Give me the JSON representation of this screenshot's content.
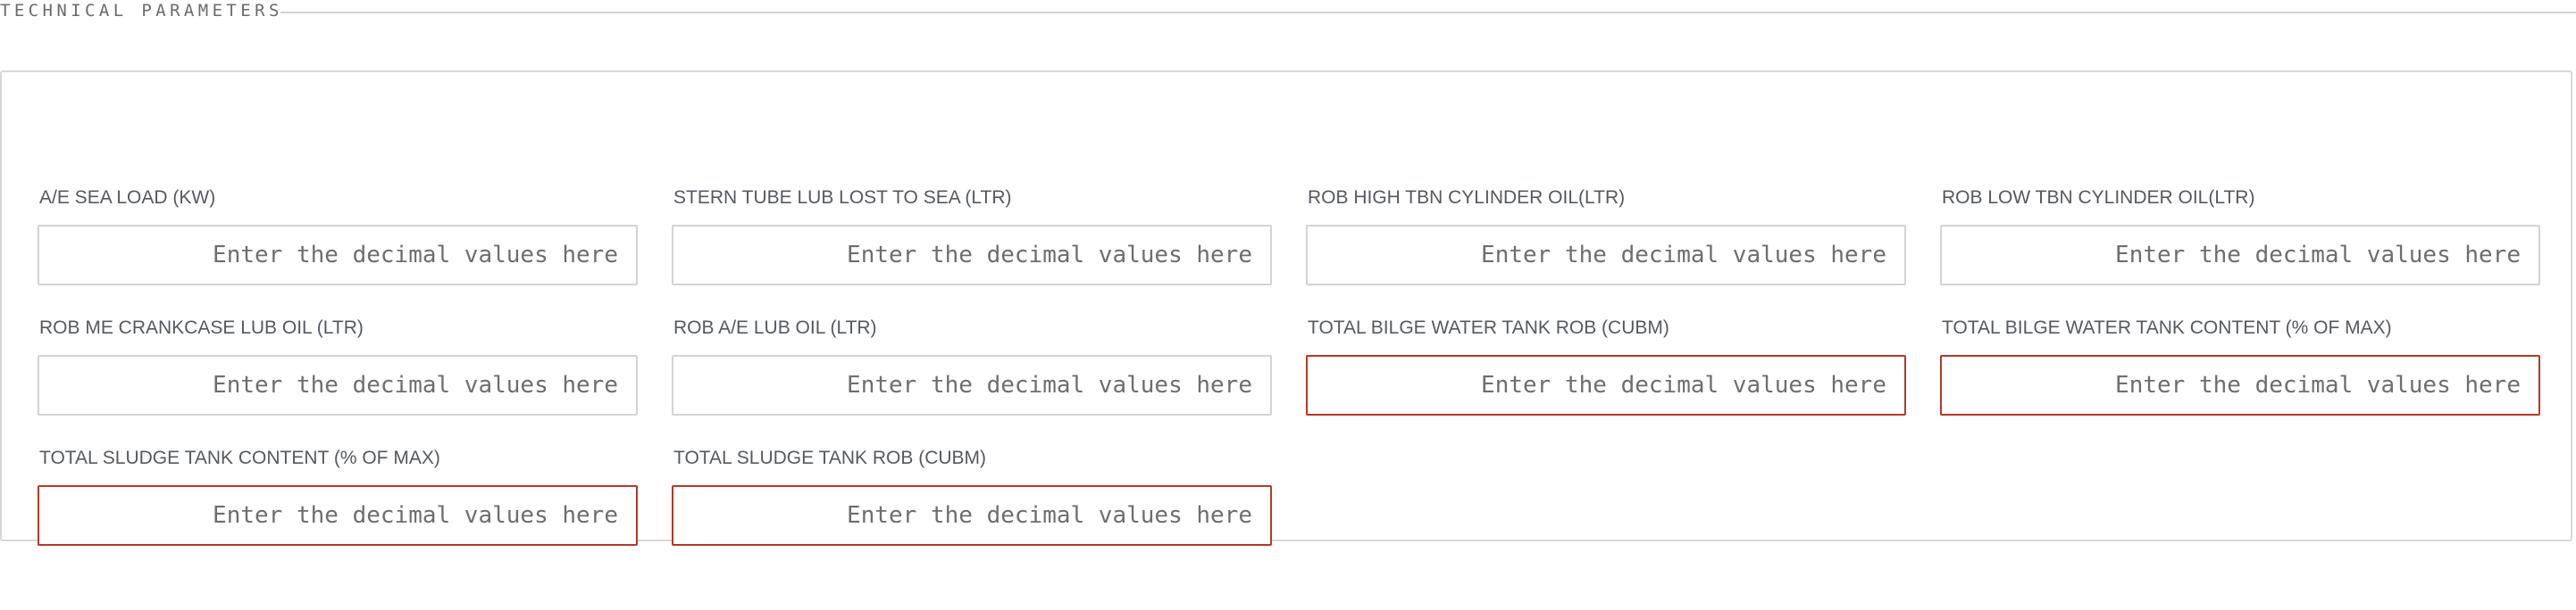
{
  "section": {
    "title": "TECHNICAL PARAMETERS"
  },
  "colors": {
    "error_border": "#b4382a",
    "default_border": "#d4d4d4",
    "label_text": "#555a60"
  },
  "fields": [
    {
      "label": "A/E SEA LOAD (KW)",
      "value": "",
      "placeholder": "Enter the decimal values here",
      "invalid": false
    },
    {
      "label": "STERN TUBE LUB LOST TO SEA (LTR)",
      "value": "",
      "placeholder": "Enter the decimal values here",
      "invalid": false
    },
    {
      "label": "ROB HIGH TBN CYLINDER OIL(LTR)",
      "value": "",
      "placeholder": "Enter the decimal values here",
      "invalid": false
    },
    {
      "label": "ROB LOW TBN CYLINDER OIL(LTR)",
      "value": "",
      "placeholder": "Enter the decimal values here",
      "invalid": false
    },
    {
      "label": "ROB ME CRANKCASE LUB OIL (LTR)",
      "value": "",
      "placeholder": "Enter the decimal values here",
      "invalid": false
    },
    {
      "label": "ROB A/E LUB OIL (LTR)",
      "value": "",
      "placeholder": "Enter the decimal values here",
      "invalid": false
    },
    {
      "label": "TOTAL BILGE WATER TANK ROB (CUBM)",
      "value": "",
      "placeholder": "Enter the decimal values here",
      "invalid": true
    },
    {
      "label": "TOTAL BILGE WATER TANK CONTENT (% OF MAX)",
      "value": "",
      "placeholder": "Enter the decimal values here",
      "invalid": true
    },
    {
      "label": "TOTAL SLUDGE TANK CONTENT (% OF MAX)",
      "value": "",
      "placeholder": "Enter the decimal values here",
      "invalid": true
    },
    {
      "label": "TOTAL SLUDGE TANK ROB (CUBM)",
      "value": "",
      "placeholder": "Enter the decimal values here",
      "invalid": true
    }
  ]
}
